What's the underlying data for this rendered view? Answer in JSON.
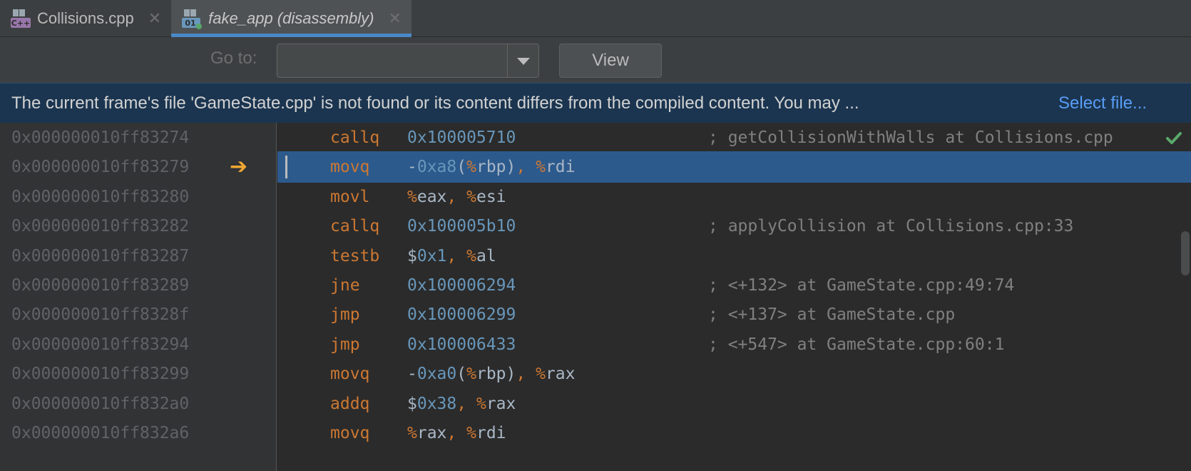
{
  "tabs": [
    {
      "label": "Collisions.cpp",
      "icon": "cpp-file-icon",
      "active": false
    },
    {
      "label": "fake_app (disassembly)",
      "icon": "disassembly-file-icon",
      "active": true
    }
  ],
  "toolbar": {
    "goto_label": "Go to:",
    "goto_value": "",
    "view_label": "View"
  },
  "notice": {
    "message": "The current frame's file 'GameState.cpp' is not found or its content differs from the compiled content. You may ...",
    "link": "Select file..."
  },
  "addresses": [
    "0x000000010ff83274",
    "0x000000010ff83279",
    "0x000000010ff83280",
    "0x000000010ff83282",
    "0x000000010ff83287",
    "0x000000010ff83289",
    "0x000000010ff8328f",
    "0x000000010ff83294",
    "0x000000010ff83299",
    "0x000000010ff832a0",
    "0x000000010ff832a6"
  ],
  "current_row": 1,
  "colors": {
    "mnemonic": "#cc7832",
    "hex": "#6897bb",
    "comment": "#808080",
    "selection": "#2d5a8c",
    "exec_arrow": "#f0a732"
  },
  "instructions": [
    {
      "mnemonic": "callq",
      "operands": [
        {
          "t": "0x100005710",
          "c": "hex"
        }
      ],
      "comment": "; getCollisionWithWalls at Collisions.cpp"
    },
    {
      "mnemonic": "movq",
      "operands": [
        {
          "t": "-",
          "c": "plain"
        },
        {
          "t": "0xa8",
          "c": "hex"
        },
        {
          "t": "(",
          "c": "plain"
        },
        {
          "t": "%",
          "c": "reg"
        },
        {
          "t": "rbp",
          "c": "plain"
        },
        {
          "t": ")",
          "c": "plain"
        },
        {
          "t": ", ",
          "c": "punc"
        },
        {
          "t": "%",
          "c": "reg"
        },
        {
          "t": "rdi",
          "c": "plain"
        }
      ],
      "comment": ""
    },
    {
      "mnemonic": "movl",
      "operands": [
        {
          "t": "%",
          "c": "reg"
        },
        {
          "t": "eax",
          "c": "plain"
        },
        {
          "t": ", ",
          "c": "punc"
        },
        {
          "t": "%",
          "c": "reg"
        },
        {
          "t": "esi",
          "c": "plain"
        }
      ],
      "comment": ""
    },
    {
      "mnemonic": "callq",
      "operands": [
        {
          "t": "0x100005b10",
          "c": "hex"
        }
      ],
      "comment": "; applyCollision at Collisions.cpp:33"
    },
    {
      "mnemonic": "testb",
      "operands": [
        {
          "t": "$",
          "c": "plain"
        },
        {
          "t": "0x1",
          "c": "hex"
        },
        {
          "t": ", ",
          "c": "punc"
        },
        {
          "t": "%",
          "c": "reg"
        },
        {
          "t": "al",
          "c": "plain"
        }
      ],
      "comment": ""
    },
    {
      "mnemonic": "jne",
      "operands": [
        {
          "t": "0x100006294",
          "c": "hex"
        }
      ],
      "comment": "; <+132> at GameState.cpp:49:74"
    },
    {
      "mnemonic": "jmp",
      "operands": [
        {
          "t": "0x100006299",
          "c": "hex"
        }
      ],
      "comment": "; <+137> at GameState.cpp"
    },
    {
      "mnemonic": "jmp",
      "operands": [
        {
          "t": "0x100006433",
          "c": "hex"
        }
      ],
      "comment": "; <+547> at GameState.cpp:60:1"
    },
    {
      "mnemonic": "movq",
      "operands": [
        {
          "t": "-",
          "c": "plain"
        },
        {
          "t": "0xa0",
          "c": "hex"
        },
        {
          "t": "(",
          "c": "plain"
        },
        {
          "t": "%",
          "c": "reg"
        },
        {
          "t": "rbp",
          "c": "plain"
        },
        {
          "t": ")",
          "c": "plain"
        },
        {
          "t": ", ",
          "c": "punc"
        },
        {
          "t": "%",
          "c": "reg"
        },
        {
          "t": "rax",
          "c": "plain"
        }
      ],
      "comment": ""
    },
    {
      "mnemonic": "addq",
      "operands": [
        {
          "t": "$",
          "c": "plain"
        },
        {
          "t": "0x38",
          "c": "hex"
        },
        {
          "t": ", ",
          "c": "punc"
        },
        {
          "t": "%",
          "c": "reg"
        },
        {
          "t": "rax",
          "c": "plain"
        }
      ],
      "comment": ""
    },
    {
      "mnemonic": "movq",
      "operands": [
        {
          "t": "%",
          "c": "reg"
        },
        {
          "t": "rax",
          "c": "plain"
        },
        {
          "t": ", ",
          "c": "punc"
        },
        {
          "t": "%",
          "c": "reg"
        },
        {
          "t": "rdi",
          "c": "plain"
        }
      ],
      "comment": ""
    }
  ]
}
